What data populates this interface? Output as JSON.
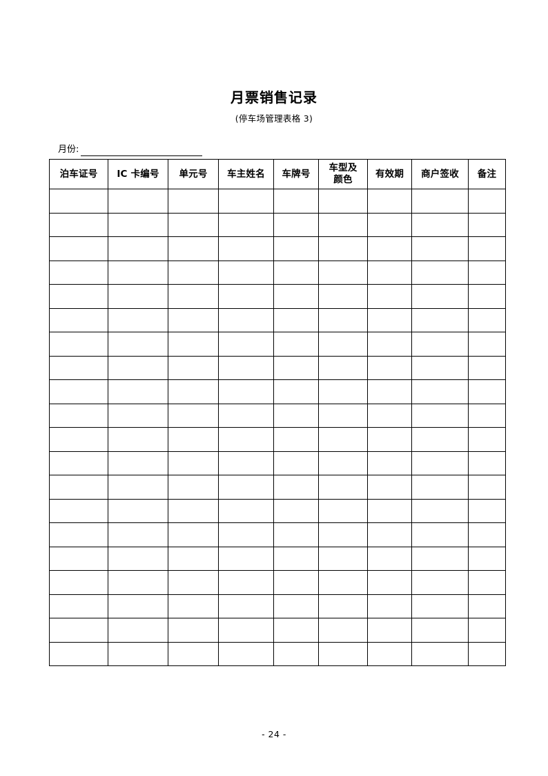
{
  "document": {
    "title": "月票销售记录",
    "subtitle": "(停车场管理表格 3)",
    "page_footer": "- 24 -"
  },
  "form_fields": {
    "month": {
      "label": "月份:",
      "value": "",
      "placeholder": ""
    }
  },
  "table": {
    "columns": [
      {
        "label": "泊车证号",
        "line1": "泊车证号",
        "line2": ""
      },
      {
        "label": "IC 卡编号",
        "line1": "IC 卡编号",
        "line2": ""
      },
      {
        "label": "单元号",
        "line1": "单元号",
        "line2": ""
      },
      {
        "label": "车主姓名",
        "line1": "车主姓名",
        "line2": ""
      },
      {
        "label": "车牌号",
        "line1": "车牌号",
        "line2": ""
      },
      {
        "label": "车型及颜色",
        "line1": "车型及",
        "line2": "颜色"
      },
      {
        "label": "有效期",
        "line1": "有效期",
        "line2": ""
      },
      {
        "label": "商户签收",
        "line1": "商户签收",
        "line2": ""
      },
      {
        "label": "备注",
        "line1": "备注",
        "line2": ""
      }
    ],
    "row_count": 20,
    "rows": [
      [
        "",
        "",
        "",
        "",
        "",
        "",
        "",
        "",
        ""
      ],
      [
        "",
        "",
        "",
        "",
        "",
        "",
        "",
        "",
        ""
      ],
      [
        "",
        "",
        "",
        "",
        "",
        "",
        "",
        "",
        ""
      ],
      [
        "",
        "",
        "",
        "",
        "",
        "",
        "",
        "",
        ""
      ],
      [
        "",
        "",
        "",
        "",
        "",
        "",
        "",
        "",
        ""
      ],
      [
        "",
        "",
        "",
        "",
        "",
        "",
        "",
        "",
        ""
      ],
      [
        "",
        "",
        "",
        "",
        "",
        "",
        "",
        "",
        ""
      ],
      [
        "",
        "",
        "",
        "",
        "",
        "",
        "",
        "",
        ""
      ],
      [
        "",
        "",
        "",
        "",
        "",
        "",
        "",
        "",
        ""
      ],
      [
        "",
        "",
        "",
        "",
        "",
        "",
        "",
        "",
        ""
      ],
      [
        "",
        "",
        "",
        "",
        "",
        "",
        "",
        "",
        ""
      ],
      [
        "",
        "",
        "",
        "",
        "",
        "",
        "",
        "",
        ""
      ],
      [
        "",
        "",
        "",
        "",
        "",
        "",
        "",
        "",
        ""
      ],
      [
        "",
        "",
        "",
        "",
        "",
        "",
        "",
        "",
        ""
      ],
      [
        "",
        "",
        "",
        "",
        "",
        "",
        "",
        "",
        ""
      ],
      [
        "",
        "",
        "",
        "",
        "",
        "",
        "",
        "",
        ""
      ],
      [
        "",
        "",
        "",
        "",
        "",
        "",
        "",
        "",
        ""
      ],
      [
        "",
        "",
        "",
        "",
        "",
        "",
        "",
        "",
        ""
      ],
      [
        "",
        "",
        "",
        "",
        "",
        "",
        "",
        "",
        ""
      ],
      [
        "",
        "",
        "",
        "",
        "",
        "",
        "",
        "",
        ""
      ]
    ]
  },
  "colors": {
    "text": "#000000",
    "border": "#000000",
    "background": "#ffffff"
  }
}
